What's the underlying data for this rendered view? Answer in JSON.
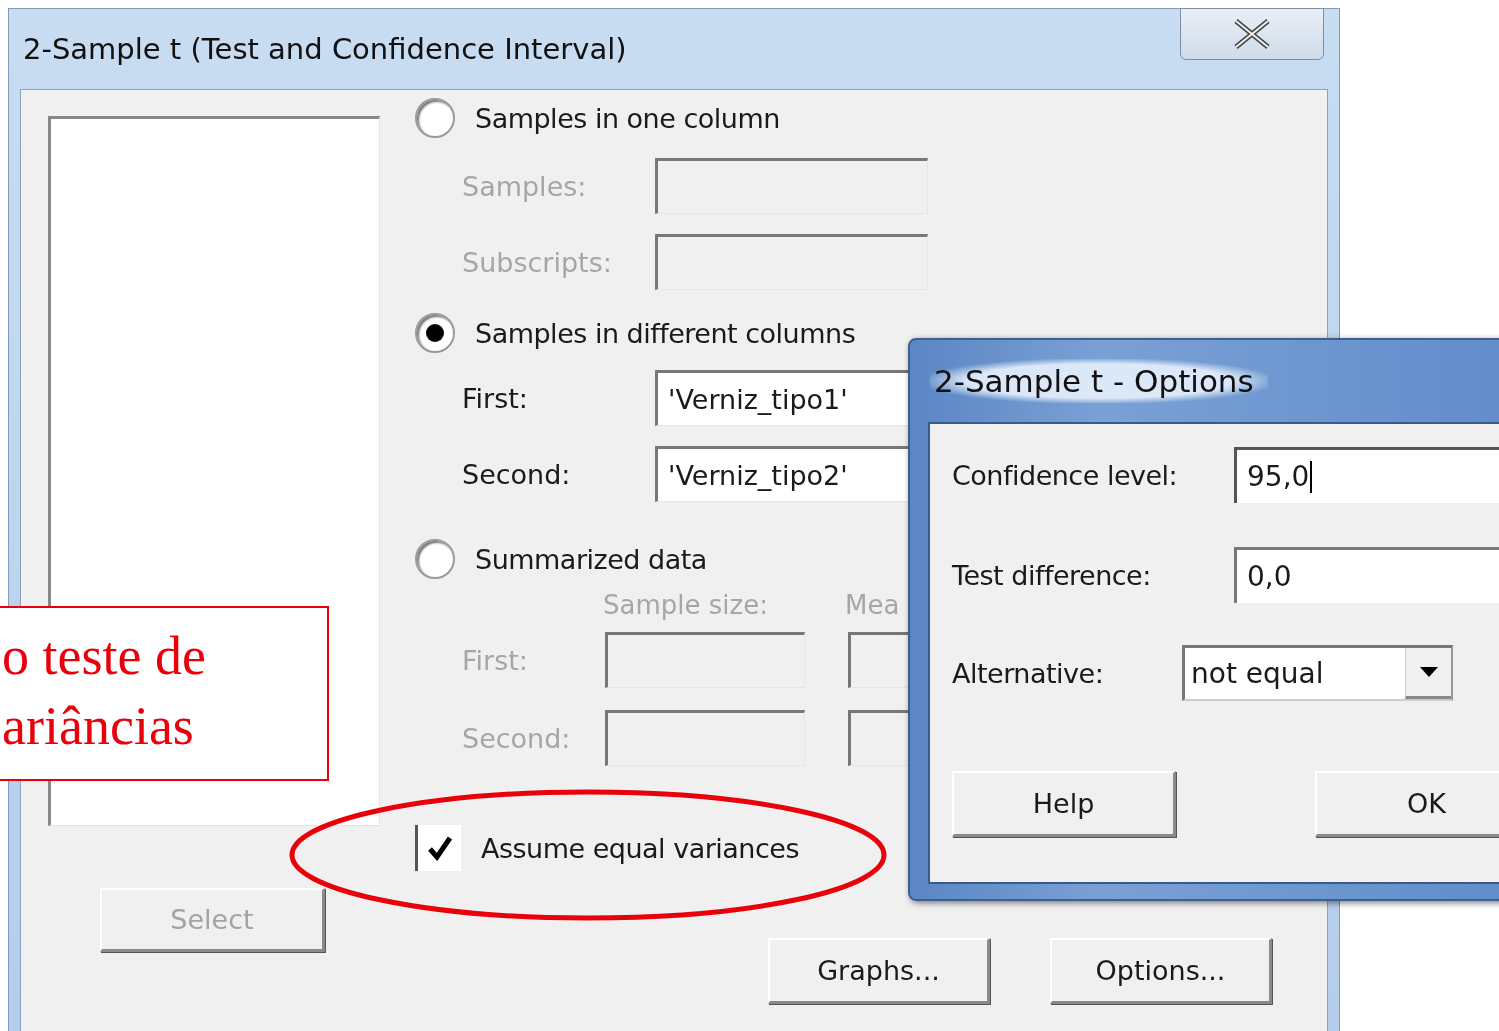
{
  "main_dialog": {
    "title": "2-Sample t (Test and Confidence Interval)",
    "sample_modes": [
      {
        "kind": "one_column",
        "label": "Samples in one column",
        "selected": false,
        "fields": [
          {
            "label": "Samples:",
            "disabled": true
          },
          {
            "label": "Subscripts:",
            "disabled": true
          }
        ]
      },
      {
        "kind": "different_columns",
        "label": "Samples in different columns",
        "selected": true,
        "fields": [
          {
            "label": "First:",
            "value": "'Verniz_tipo1'",
            "disabled": false
          },
          {
            "label": "Second:",
            "value": "'Verniz_tipo2'",
            "disabled": false
          }
        ]
      },
      {
        "kind": "summarized",
        "label": "Summarized data",
        "selected": false,
        "columns": [
          "Sample size:",
          "Mea"
        ],
        "rows": [
          {
            "label": "First:",
            "disabled": true
          },
          {
            "label": "Second:",
            "disabled": true
          }
        ]
      }
    ],
    "assume_equal_variances": {
      "label": "Assume equal variances",
      "checked": true
    },
    "select_button": {
      "label": "Select",
      "disabled": true
    },
    "buttons": [
      "Graphs...",
      "Options..."
    ]
  },
  "options_dialog": {
    "title": "2-Sample t - Options",
    "fields": [
      {
        "label": "Confidence level:",
        "value": "95,0",
        "focused": true
      },
      {
        "label": "Test difference:",
        "value": "0,0",
        "focused": false
      }
    ],
    "alternative": {
      "label": "Alternative:",
      "value": "not equal"
    },
    "buttons": [
      "Help",
      "OK"
    ]
  },
  "annotation": {
    "lines": [
      "o teste de",
      "ariâncias"
    ]
  }
}
